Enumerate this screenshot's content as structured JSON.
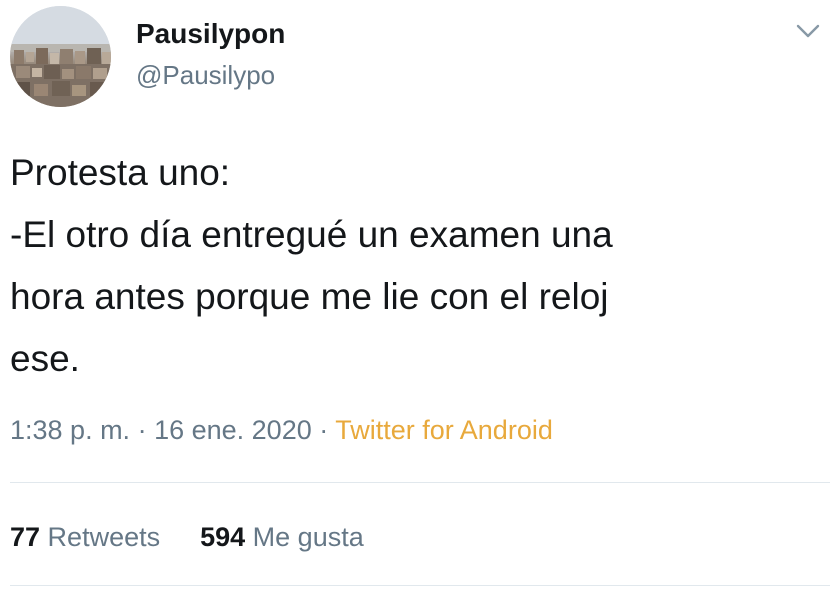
{
  "author": {
    "display_name": "Pausilypon",
    "handle": "@Pausilypo"
  },
  "tweet": {
    "text": "Protesta uno:\n-El otro día entregué un examen una\nhora antes porque me lie con el reloj\nese.",
    "time": "1:38 p. m.",
    "separator1": " · ",
    "date": "16 ene. 2020",
    "separator2": " · ",
    "source": "Twitter for Android"
  },
  "stats": {
    "retweets_count": "77",
    "retweets_label": " Retweets",
    "likes_count": "594",
    "likes_label": " Me gusta"
  },
  "icons": {
    "menu": "chevron-down-icon"
  },
  "colors": {
    "text": "#14171a",
    "secondary": "#657786",
    "source_link": "#e8a93c",
    "divider": "#e1e8ed"
  }
}
